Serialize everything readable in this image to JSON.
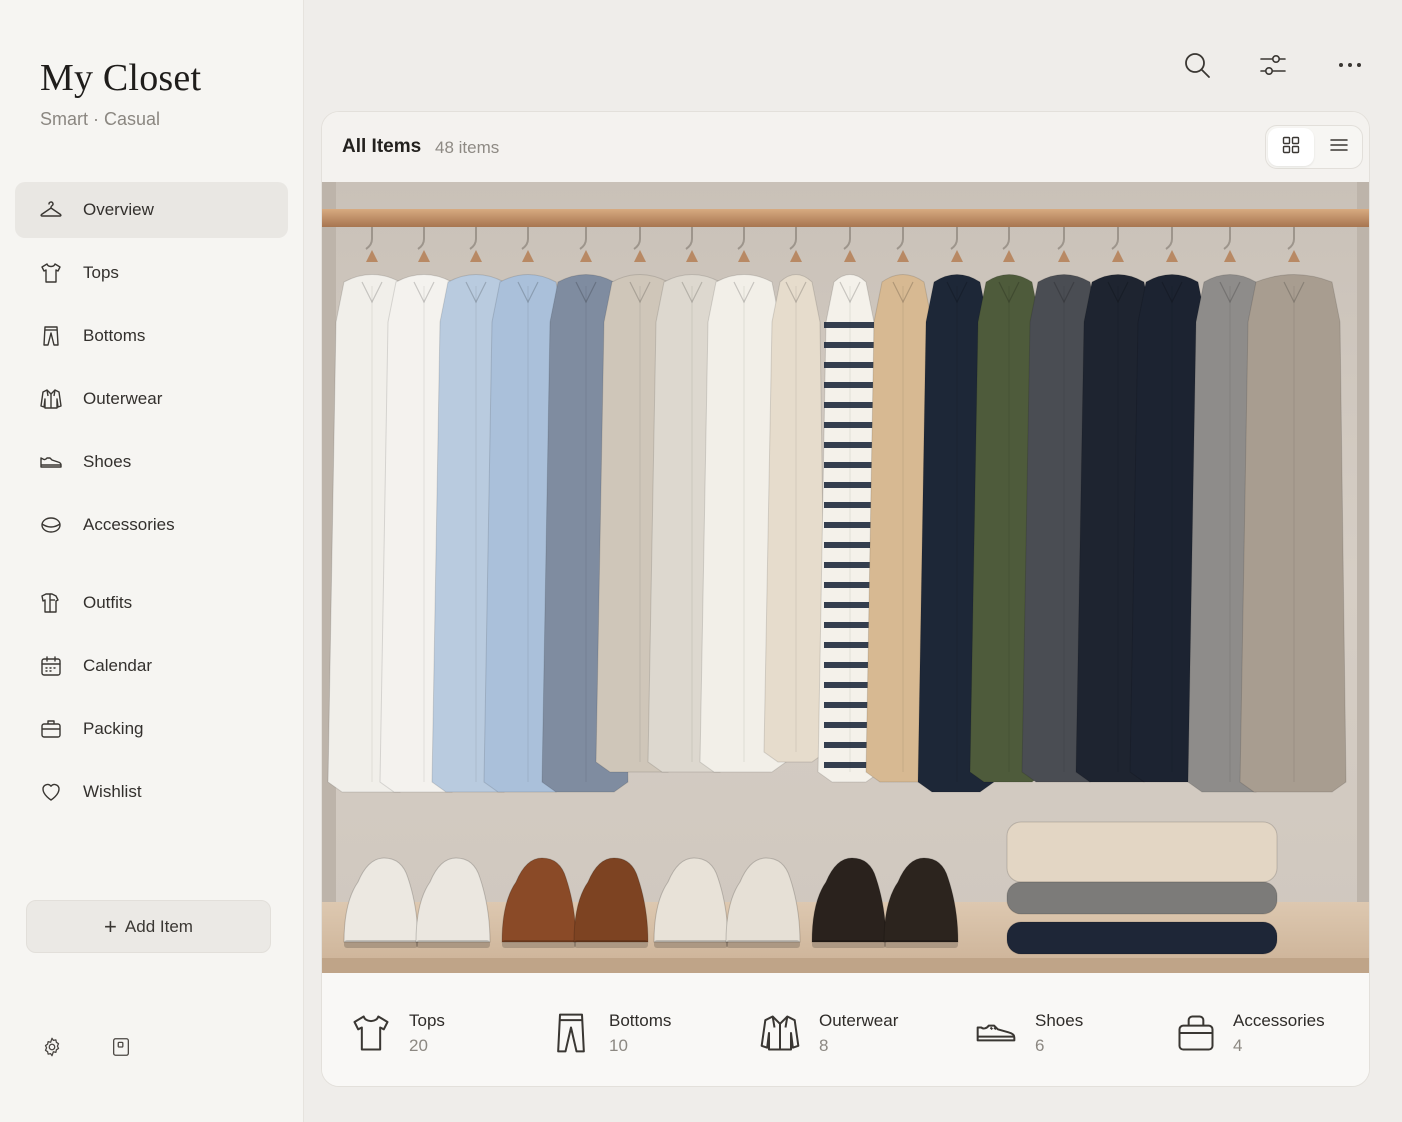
{
  "app": {
    "title": "My Closet",
    "subtitle": "Smart · Casual"
  },
  "sidebar": {
    "items": [
      {
        "label": "Overview",
        "icon": "hanger-icon",
        "active": true
      },
      {
        "label": "Tops",
        "icon": "tshirt-icon"
      },
      {
        "label": "Bottoms",
        "icon": "pants-icon"
      },
      {
        "label": "Outerwear",
        "icon": "jacket-icon"
      },
      {
        "label": "Shoes",
        "icon": "shoe-icon"
      },
      {
        "label": "Accessories",
        "icon": "accessory-icon"
      },
      {
        "label": "Outfits",
        "icon": "outfit-icon"
      },
      {
        "label": "Calendar",
        "icon": "calendar-icon"
      },
      {
        "label": "Packing",
        "icon": "suitcase-icon"
      },
      {
        "label": "Wishlist",
        "icon": "heart-icon"
      }
    ],
    "add_button": {
      "label": "Add Item",
      "icon": "plus-icon"
    },
    "footer_icons": [
      "gear-icon",
      "tablet-icon"
    ]
  },
  "toolbar": {
    "icons": [
      "search-icon",
      "filter-sliders-icon",
      "more-icon"
    ]
  },
  "main": {
    "title": "All Items",
    "count": "48 items",
    "view_modes": [
      {
        "name": "grid",
        "icon": "grid-icon",
        "selected": true
      },
      {
        "name": "list",
        "icon": "list-icon",
        "selected": false
      }
    ],
    "stats": [
      {
        "label": "Tops",
        "value": "20",
        "icon": "tshirt-icon"
      },
      {
        "label": "Bottoms",
        "value": "10",
        "icon": "pants-icon"
      },
      {
        "label": "Outerwear",
        "value": "8",
        "icon": "jacket-icon"
      },
      {
        "label": "Shoes",
        "value": "6",
        "icon": "shoe-icon"
      },
      {
        "label": "Accessories",
        "value": "4",
        "icon": "bag-icon"
      }
    ]
  },
  "colors": {
    "background": "#efedea",
    "sidebar": "#f6f5f2",
    "active_nav": "#e9e7e3",
    "text": "#2b2926",
    "muted": "#8b8781",
    "rail": "#b98860"
  }
}
